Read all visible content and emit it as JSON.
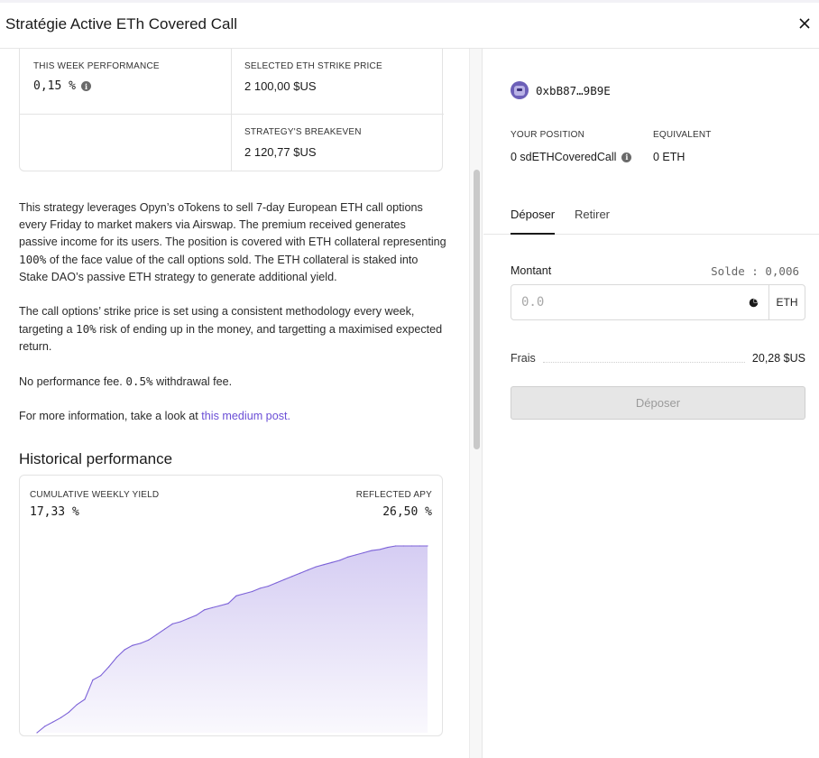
{
  "modal": {
    "title": "Stratégie Active ETh Covered Call"
  },
  "stats": {
    "week_perf_label": "THIS WEEK PERFORMANCE",
    "week_perf_value": "0,15 %",
    "strike_label": "SELECTED ETH STRIKE PRICE",
    "strike_value": "2 100,00 $US",
    "breakeven_label": "STRATEGY'S BREAKEVEN",
    "breakeven_value": "2 120,77 $US"
  },
  "description": {
    "p1_a": "This strategy leverages Opyn’s oTokens to sell 7-day European ETH call options every Friday to market makers via Airswap. The premium received generates passive income for its users. The position is covered with ETH collateral representing ",
    "p1_b": "100%",
    "p1_c": " of the face value of the call options sold. The ETH collateral is staked into Stake DAO’s passive ETH strategy to generate additional yield.",
    "p2_a": "The call options’ strike price is set using a consistent methodology every week, targeting a ",
    "p2_b": "10%",
    "p2_c": " risk of ending up in the money, and targetting a maximised expected return.",
    "p3_a": "No performance fee. ",
    "p3_b": "0.5%",
    "p3_c": " withdrawal fee.",
    "p4_a": "For more information, take a look at ",
    "p4_link": "this medium post."
  },
  "history": {
    "title": "Historical performance",
    "cumulative_label": "CUMULATIVE WEEKLY YIELD",
    "cumulative_value": "17,33 %",
    "apy_label": "REFLECTED APY",
    "apy_value": "26,50 %"
  },
  "chart_data": {
    "type": "area",
    "title": "",
    "xlabel": "",
    "ylabel": "",
    "grid": false,
    "x": [
      1,
      2,
      3,
      4,
      5,
      6,
      7,
      8,
      9,
      10,
      11,
      12,
      13,
      14,
      15,
      16,
      17,
      18,
      19,
      20,
      21,
      22,
      23,
      24,
      25,
      26,
      27,
      28,
      29,
      30,
      31,
      32,
      33,
      34,
      35,
      36,
      37,
      38,
      39,
      40,
      41,
      42,
      43,
      44,
      45,
      46,
      47,
      48,
      49,
      50
    ],
    "values": [
      0.0,
      0.6,
      1.0,
      1.4,
      1.9,
      2.6,
      3.1,
      4.9,
      5.3,
      6.1,
      7.0,
      7.7,
      8.1,
      8.3,
      8.6,
      9.1,
      9.6,
      10.1,
      10.3,
      10.6,
      10.9,
      11.4,
      11.6,
      11.8,
      12.0,
      12.7,
      12.9,
      13.1,
      13.4,
      13.6,
      13.9,
      14.2,
      14.5,
      14.8,
      15.1,
      15.4,
      15.6,
      15.8,
      16.0,
      16.3,
      16.5,
      16.7,
      16.9,
      17.0,
      17.2,
      17.33,
      17.33,
      17.33,
      17.33,
      17.33
    ],
    "ylim": [
      0,
      17.33
    ],
    "color": "#7c62d8"
  },
  "wallet": {
    "address": "0xbB87…9B9E"
  },
  "position": {
    "label": "YOUR POSITION",
    "value": "0 sdETHCoveredCall",
    "equiv_label": "EQUIVALENT",
    "equiv_value": "0 ETH"
  },
  "tabs": [
    "Déposer",
    "Retirer"
  ],
  "form": {
    "amount_label": "Montant",
    "balance": "Solde : 0,006",
    "placeholder": "0.0",
    "unit": "ETH",
    "fee_label": "Frais",
    "fee_value": "20,28 $US",
    "submit": "Déposer"
  }
}
